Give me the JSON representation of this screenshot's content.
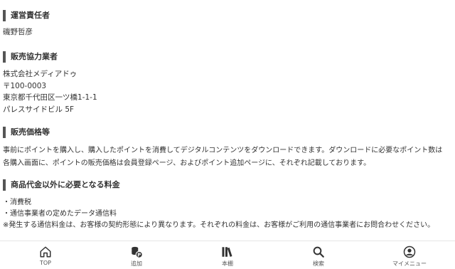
{
  "sections": [
    {
      "heading": "運営責任者",
      "lines": [
        "磯野哲彦"
      ]
    },
    {
      "heading": "販売協力業者",
      "lines": [
        "株式会社メディアドゥ",
        "〒100-0003",
        "東京都千代田区一ツ橋1-1-1",
        "パレスサイドビル 5F"
      ]
    },
    {
      "heading": "販売価格等",
      "text": "事前にポイントを購入し、購入したポイントを消費してデジタルコンテンツをダウンロードできます。ダウンロードに必要なポイント数は各購入画面に、ポイントの販売価格は会員登録ページ、およびポイント追加ページに、それぞれ記載しております。"
    },
    {
      "heading": "商品代金以外に必要となる料金",
      "lines": [
        "・消費税",
        "・通信事業者の定めたデータ通信料",
        "※発生する通信料金は、お客様の契約形態により異なります。それぞれの料金は、お客様がご利用の通信事業者にお問合わせください。"
      ]
    }
  ],
  "tabbar": {
    "items": [
      {
        "label": "TOP",
        "icon": "home-icon"
      },
      {
        "label": "追加",
        "icon": "coins-icon"
      },
      {
        "label": "本棚",
        "icon": "bookshelf-icon"
      },
      {
        "label": "検索",
        "icon": "search-icon"
      },
      {
        "label": "マイメニュー",
        "icon": "user-icon"
      }
    ]
  },
  "colors": {
    "heading_bar": "#555555",
    "text": "#333333",
    "tabbar_border": "#e6e6e6"
  }
}
